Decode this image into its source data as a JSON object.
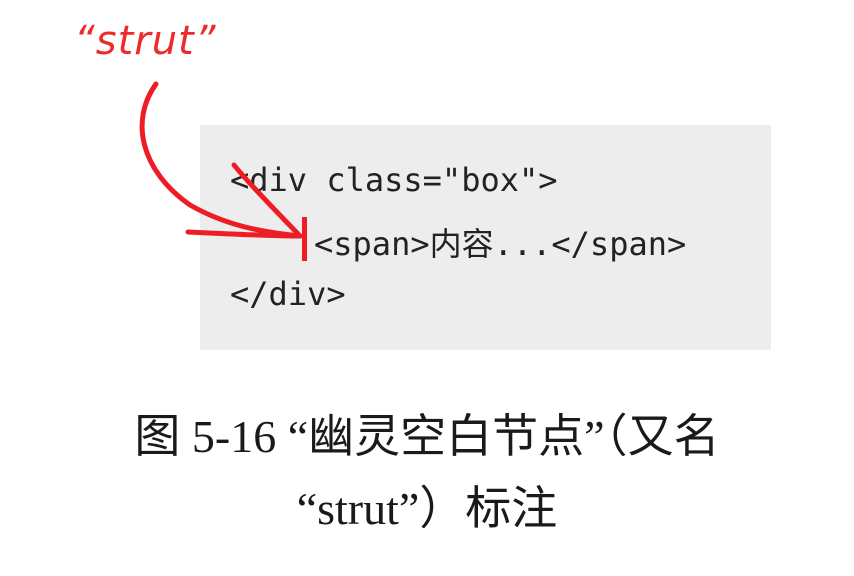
{
  "annotation": {
    "label": "“strut”",
    "color": "#ee2b2b"
  },
  "code": {
    "background": "#ededed",
    "lines": [
      "<div class=\"box\">",
      "<span>内容...</span>",
      "</div>"
    ],
    "marker_color": "#ee1c24"
  },
  "caption": {
    "line1": "图 5-16 “幽灵空白节点”（又名",
    "line2": "“strut”）标注"
  }
}
